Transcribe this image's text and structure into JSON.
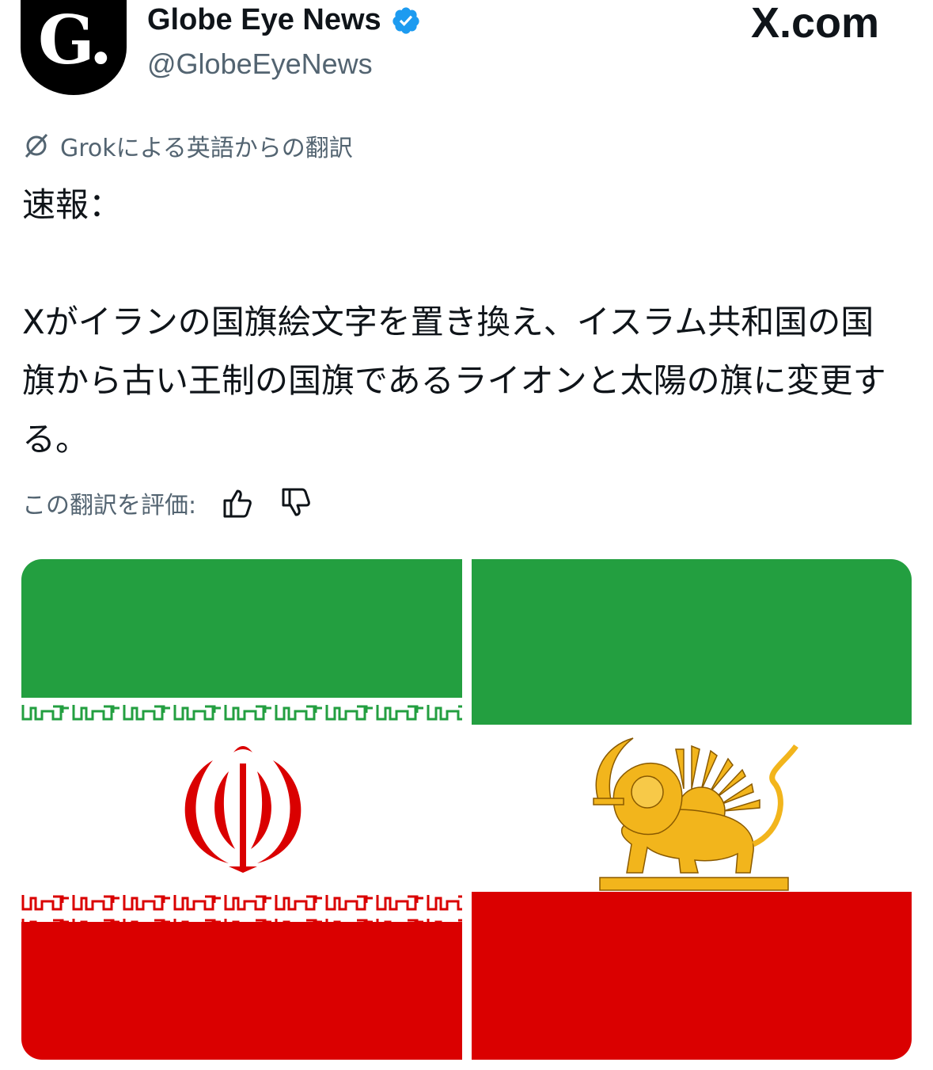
{
  "post": {
    "author": {
      "avatar_letter": "G.",
      "display_name": "Globe Eye News",
      "handle": "@GlobeEyeNews",
      "verified": true
    },
    "source_watermark": "X.com",
    "translation_note": "Grokによる英語からの翻訳",
    "body": "速報：\n\nXがイランの国旗絵文字を置き換え、イスラム共和国の国旗から古い王制の国旗であるライオンと太陽の旗に変更する。",
    "rate_translation_label": "この翻訳を評価:",
    "media": [
      {
        "name": "islamic-republic-flag",
        "colors": [
          "#239f40",
          "#ffffff",
          "#da0000"
        ]
      },
      {
        "name": "lion-and-sun-flag",
        "colors": [
          "#239f40",
          "#ffffff",
          "#da0000",
          "#f2b51c"
        ]
      }
    ]
  },
  "colors": {
    "text": "#0f1419",
    "secondary": "#536471",
    "verified": "#1d9bf0"
  },
  "icons": [
    "verified-badge-icon",
    "grok-icon",
    "thumbs-up-icon",
    "thumbs-down-icon"
  ]
}
